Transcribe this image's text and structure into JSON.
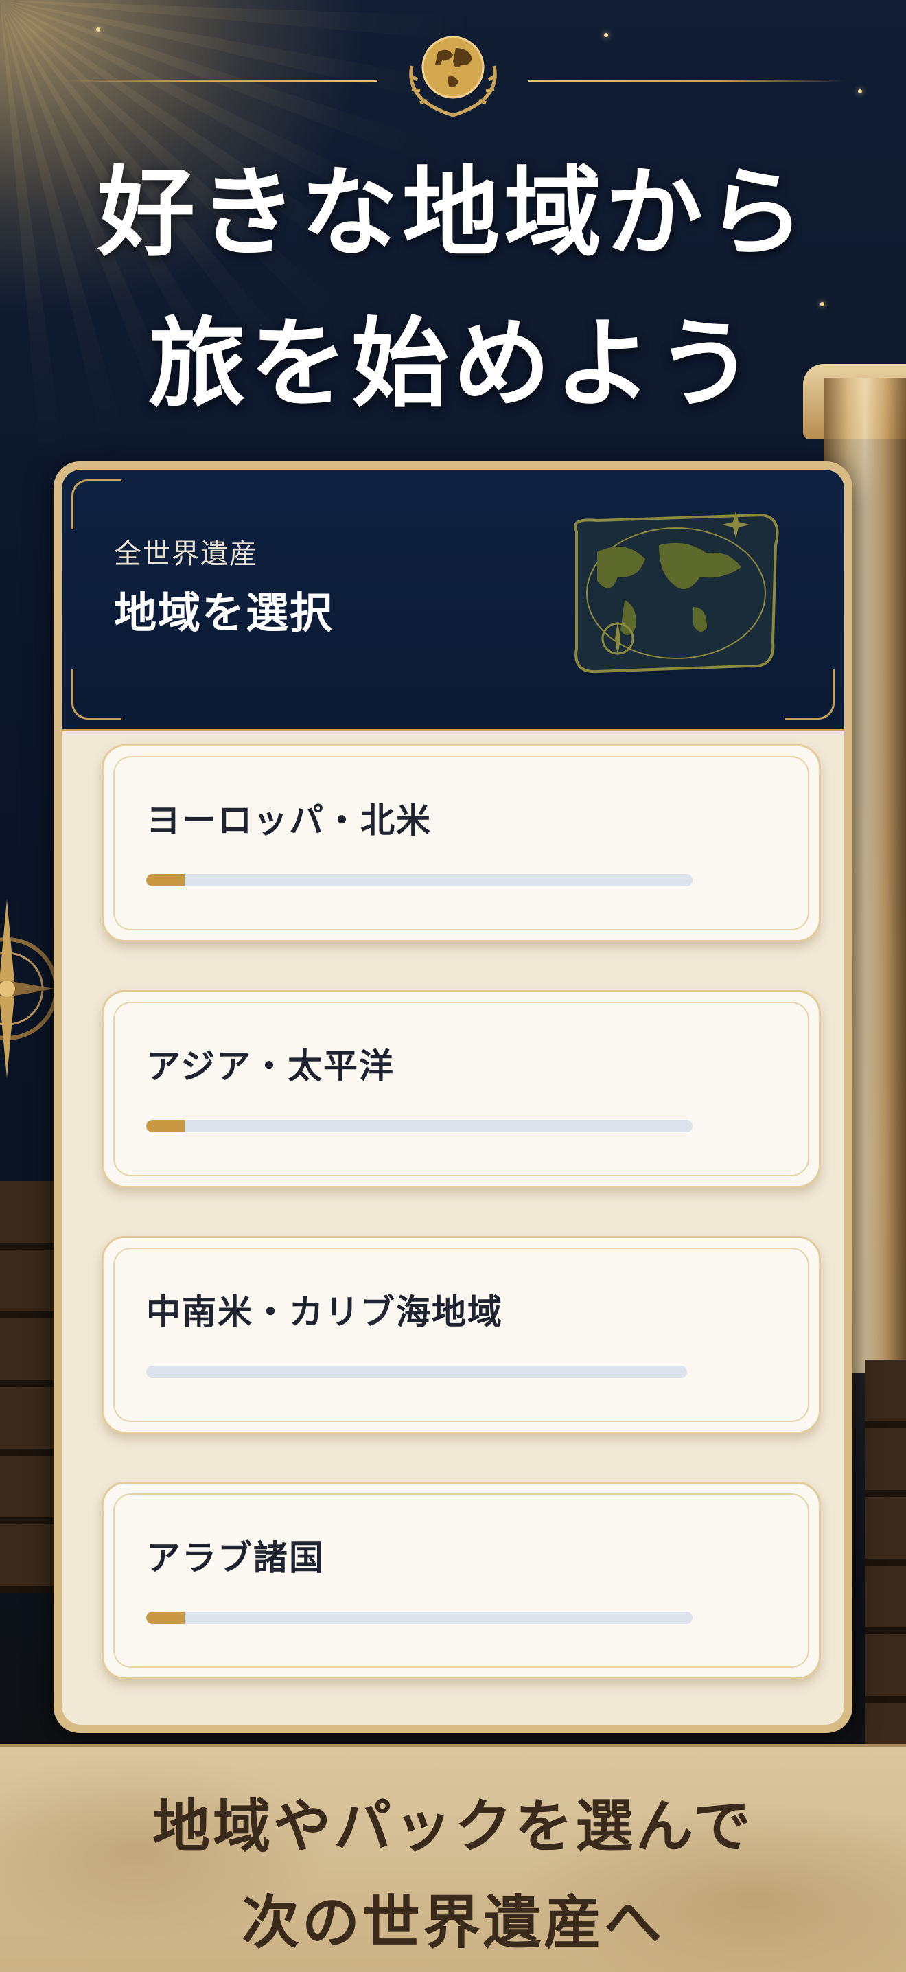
{
  "headline": {
    "line1": "好きな地域から",
    "line2": "旅を始めよう"
  },
  "panel": {
    "subtitle": "全世界遺産",
    "title": "地域を選択"
  },
  "regions": [
    {
      "name": "ヨーロッパ・北米",
      "progress": 0.07
    },
    {
      "name": "アジア・太平洋",
      "progress": 0.07
    },
    {
      "name": "中南米・カリブ海地域",
      "progress": 0.0
    },
    {
      "name": "アラブ諸国",
      "progress": 0.07
    }
  ],
  "banner": {
    "line1": "地域やパックを選んで",
    "line2": "次の世界遺産へ"
  },
  "colors": {
    "header_bg": "#0f2141",
    "gold": "#c9a35a",
    "progress_fill": "#c99842",
    "progress_track": "#dde3ec",
    "card_bg": "#fbf8f1"
  },
  "icons": [
    "globe-emblem-icon",
    "world-map-icon",
    "compass-icon"
  ]
}
